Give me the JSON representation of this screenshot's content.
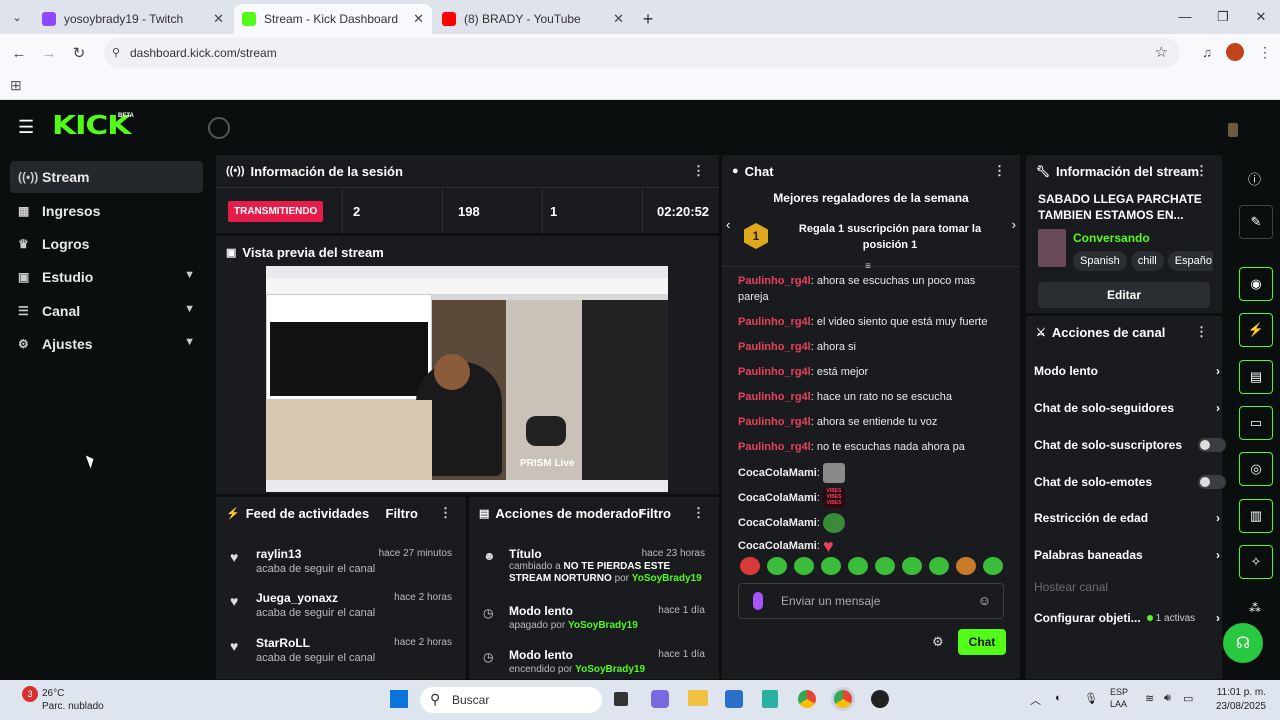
{
  "browser": {
    "tabs": [
      {
        "title": "yosoybrady19 - Twitch",
        "color": "#9146ff"
      },
      {
        "title": "Stream - Kick Dashboard",
        "color": "#53fc18"
      },
      {
        "title": "(8) BRADY - YouTube",
        "color": "#ff0000"
      }
    ],
    "url": "dashboard.kick.com/stream"
  },
  "header": {
    "logo": "KICK",
    "beta": "BETA"
  },
  "sidebar": {
    "items": [
      {
        "label": "Stream",
        "icon": "((•))"
      },
      {
        "label": "Ingresos",
        "icon": "▦"
      },
      {
        "label": "Logros",
        "icon": "♛"
      },
      {
        "label": "Estudio",
        "icon": "▣"
      },
      {
        "label": "Canal",
        "icon": "☰"
      },
      {
        "label": "Ajustes",
        "icon": "⚙"
      }
    ]
  },
  "session": {
    "title": "Información de la sesión",
    "badge": "TRANSMITIENDO",
    "stats": [
      "2",
      "198",
      "1"
    ],
    "duration": "02:20:52"
  },
  "preview": {
    "title": "Vista previa del stream",
    "overlay": "PRISM Live"
  },
  "feed": {
    "title": "Feed de actividades",
    "filter": "Filtro",
    "items": [
      {
        "name": "raylin13",
        "sub": "acaba de seguir el canal",
        "time": "hace 27 minutos"
      },
      {
        "name": "Juega_yonaxz",
        "sub": "acaba de seguir el canal",
        "time": "hace 2 horas"
      },
      {
        "name": "StarRoLL",
        "sub": "acaba de seguir el canal",
        "time": "hace 2 horas"
      }
    ]
  },
  "modactions": {
    "title": "Acciones de moderador",
    "filter": "Filtro",
    "items": [
      {
        "name": "Título",
        "time": "hace 23 horas",
        "pre": "cambiado a",
        "detail": "NO TE PIERDAS ESTE STREAM NORTURNO",
        "by": "por",
        "user": "YoSoyBrady19"
      },
      {
        "name": "Modo lento",
        "time": "hace 1 día",
        "pre": "apagado por",
        "user": "YoSoyBrady19"
      },
      {
        "name": "Modo lento",
        "time": "hace 1 día",
        "pre": "encendido por",
        "user": "YoSoyBrady19"
      }
    ]
  },
  "chat": {
    "title": "Chat",
    "top_title": "Mejores regaladores de la semana",
    "rank": "1",
    "gift_text": "Regala 1 suscripción para tomar la posición 1",
    "messages": [
      {
        "user": "Paulinho_rg4l",
        "text": ": ahora se escuchas un poco mas pareja"
      },
      {
        "user": "Paulinho_rg4l",
        "text": ": el video siento que está muy fuerte"
      },
      {
        "user": "Paulinho_rg4l",
        "text": ": ahora si"
      },
      {
        "user": "Paulinho_rg4l",
        "text": ": está mejor"
      },
      {
        "user": "Paulinho_rg4l",
        "text": ": hace un rato no se escucha"
      },
      {
        "user": "Paulinho_rg4l",
        "text": ": ahora se entiende tu voz"
      },
      {
        "user": "Paulinho_rg4l",
        "text": ": no te escuchas nada ahora pa"
      },
      {
        "user": "CocaColaMami",
        "text": ":"
      },
      {
        "user": "CocaColaMami",
        "text": ":"
      },
      {
        "user": "CocaColaMami",
        "text": ":"
      },
      {
        "user": "CocaColaMami",
        "text": ":"
      }
    ],
    "emote_vibes": "VIBES VIBES VIBES",
    "input_placeholder": "Enviar un mensaje",
    "send": "Chat"
  },
  "streaminfo": {
    "title": "Información del stream",
    "stream_title": "SABADO LLEGA PARCHATE TAMBIEN ESTAMOS EN...",
    "category": "Conversando",
    "tags": [
      "Spanish",
      "chill",
      "Españo"
    ],
    "edit": "Editar"
  },
  "channel": {
    "title": "Acciones de canal",
    "items": [
      {
        "label": "Modo lento",
        "kind": "chevron"
      },
      {
        "label": "Chat de solo-seguidores",
        "kind": "chevron"
      },
      {
        "label": "Chat de solo-suscriptores",
        "kind": "toggle"
      },
      {
        "label": "Chat de solo-emotes",
        "kind": "toggle"
      },
      {
        "label": "Restricción de edad",
        "kind": "chevron"
      },
      {
        "label": "Palabras baneadas",
        "kind": "chevron"
      }
    ],
    "host": "Hostear canal",
    "goals": "Configurar objeti...",
    "goals_active": "1 activas"
  },
  "taskbar": {
    "temp": "26°C",
    "weather": "Parc. nublado",
    "weather_badge": "3",
    "search": "Buscar",
    "lang": "ESP",
    "lang2": "LAA",
    "time": "11:01 p. m.",
    "date": "23/08/2025"
  }
}
